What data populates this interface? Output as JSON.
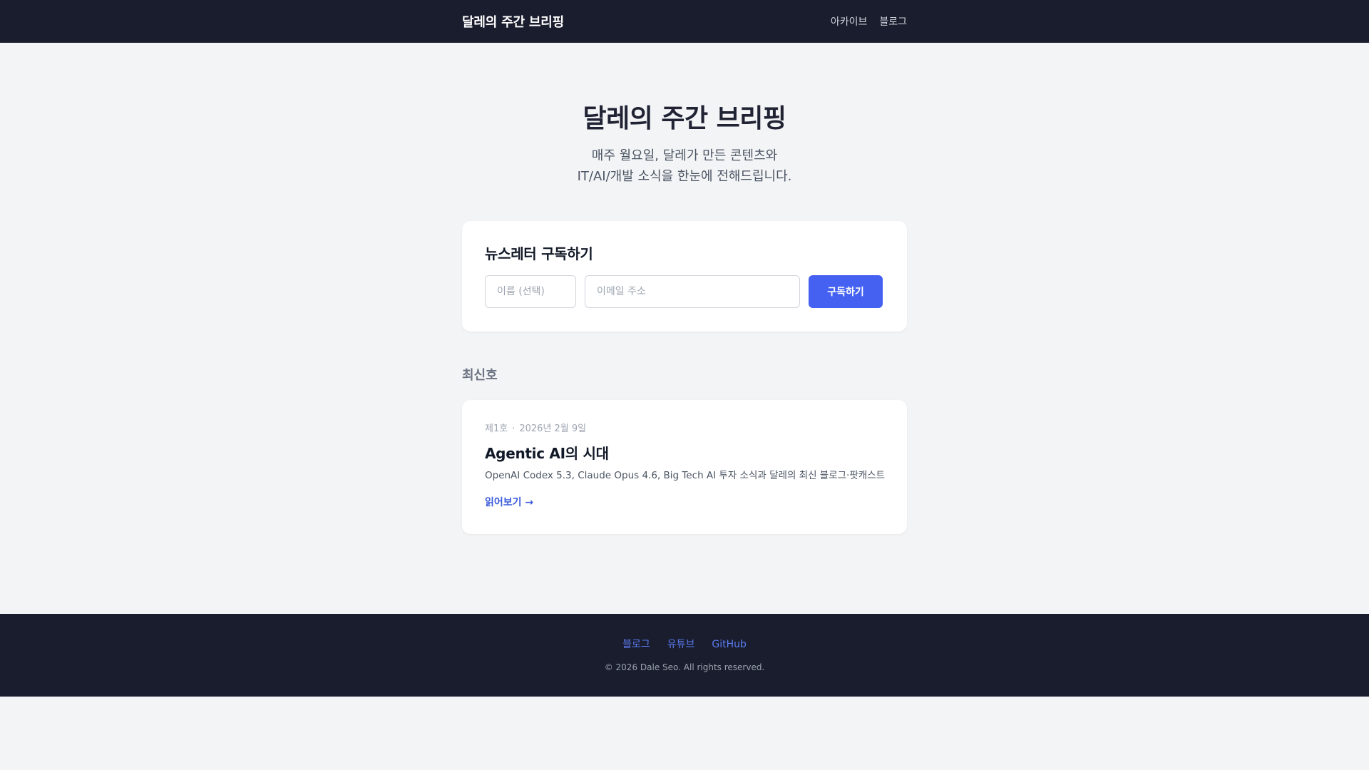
{
  "header": {
    "brand": "달레의 주간 브리핑",
    "nav": [
      {
        "label": "아카이브"
      },
      {
        "label": "블로그"
      }
    ]
  },
  "hero": {
    "title": "달레의 주간 브리핑",
    "subtitle_line1": "매주 월요일, 달레가 만든 콘텐츠와",
    "subtitle_line2": "IT/AI/개발 소식을 한눈에 전해드립니다."
  },
  "subscribe": {
    "heading": "뉴스레터 구독하기",
    "name_placeholder": "이름 (선택)",
    "email_placeholder": "이메일 주소",
    "button_label": "구독하기"
  },
  "latest": {
    "heading": "최신호",
    "issue": {
      "number": "제1호",
      "separator": "·",
      "date": "2026년 2월 9일",
      "title": "Agentic AI의 시대",
      "description": "OpenAI Codex 5.3, Claude Opus 4.6, Big Tech AI 투자 소식과 달레의 최신 블로그·팟캐스트",
      "read_more": "읽어보기 →"
    }
  },
  "footer": {
    "links": [
      {
        "label": "블로그"
      },
      {
        "label": "유튜브"
      },
      {
        "label": "GitHub"
      }
    ],
    "copyright": "© 2026 Dale Seo. All rights reserved."
  },
  "colors": {
    "header_bg": "#1a1d2e",
    "page_bg": "#f3f4f6",
    "accent": "#4461f2",
    "link": "#3b5bdb"
  }
}
